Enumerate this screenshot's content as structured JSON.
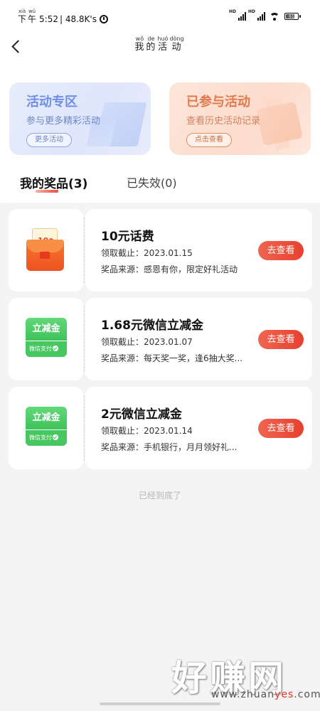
{
  "status_bar": {
    "period_pinyin": [
      "xià",
      "wǔ"
    ],
    "period_chars": [
      "下",
      "午"
    ],
    "time": "5:52",
    "net_speed": "| 48.8K's",
    "hd_1": "HD",
    "hd_2": "HD",
    "battery": "61"
  },
  "header": {
    "title_pinyin": [
      "wǒ",
      "de",
      "huó",
      "dòng"
    ],
    "title_chars": [
      "我",
      "的",
      "活",
      "动"
    ]
  },
  "banners": [
    {
      "title": "活动专区",
      "subtitle": "参与更多精彩活动",
      "button": "更多活动",
      "color": "#6f8ee4"
    },
    {
      "title": "已参与活动",
      "subtitle": "查看历史活动记录",
      "button": "点击查看",
      "color": "#e07a4d"
    }
  ],
  "tabs": {
    "mine": "我的奖品(3)",
    "expired": "已失效(0)"
  },
  "prizes": [
    {
      "icon": "red-envelope-icon",
      "icon_amount": "10",
      "name": "10元话费",
      "deadline_label": "领取截止：",
      "deadline": "2023.01.15",
      "source_label": "奖品来源：",
      "source": "感恩有你，限定好礼活动",
      "action": "去查看"
    },
    {
      "icon": "wechat-pay-discount-icon",
      "icon_title": "立减金",
      "icon_sub": "微信支付",
      "name": "1.68元微信立减金",
      "deadline_label": "领取截止：",
      "deadline": "2023.01.07",
      "source_label": "奖品来源：",
      "source": "每天奖一奖，逢6抽大奖...",
      "action": "去查看"
    },
    {
      "icon": "wechat-pay-discount-icon",
      "icon_title": "立减金",
      "icon_sub": "微信支付",
      "name": "2元微信立减金",
      "deadline_label": "领取截止：",
      "deadline": "2023.01.14",
      "source_label": "奖品来源：",
      "source": "手机银行，月月领好礼...",
      "action": "去查看"
    }
  ],
  "end_text": "已经到底了",
  "watermark": {
    "text": "好赚网",
    "url_prefix": "www.zhuan",
    "url_highlight": "yes",
    "url_suffix": ".com"
  },
  "colors": {
    "accent": "#e8402f",
    "wechat_green": "#46c760",
    "background": "#f4f4f5"
  }
}
